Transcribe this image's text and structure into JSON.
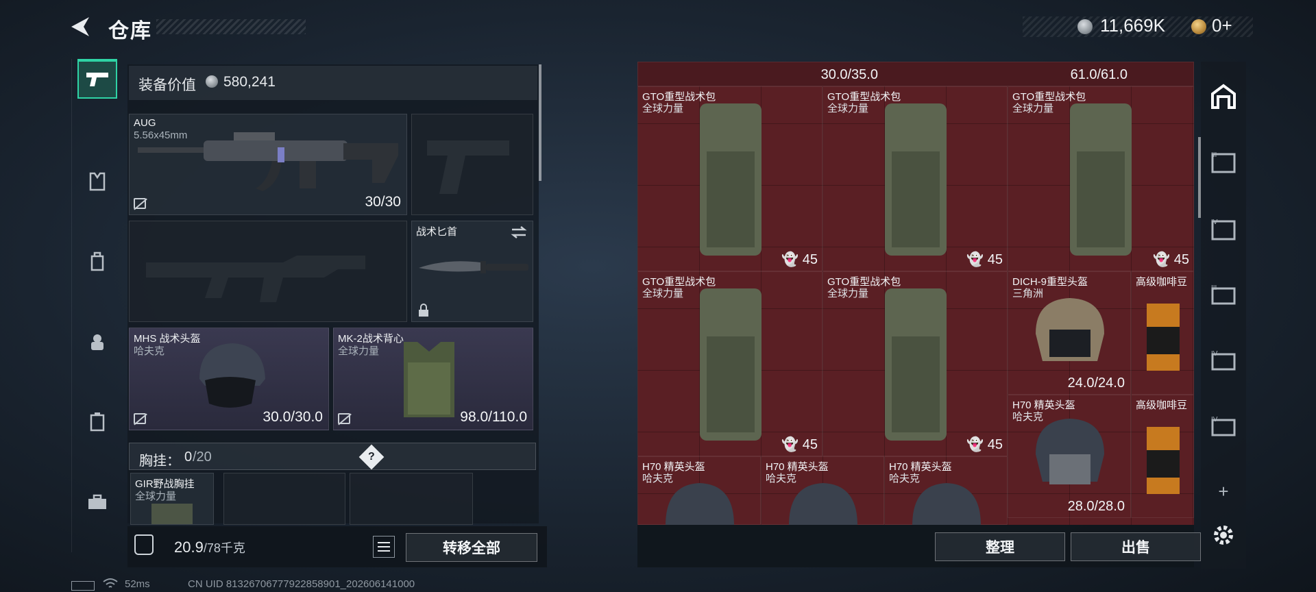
{
  "header": {
    "title": "仓库",
    "money": "11,669K",
    "gold": "0+"
  },
  "tabs": [
    {
      "icon": "pistol-icon",
      "active": true
    },
    {
      "icon": "vest-icon"
    },
    {
      "icon": "backpack-icon"
    },
    {
      "icon": "rig-icon"
    },
    {
      "icon": "case-icon"
    },
    {
      "icon": "toolbox-icon"
    }
  ],
  "loadout": {
    "equip_value_label": "装备价值",
    "equip_value": "580,241",
    "primary": {
      "name": "AUG",
      "caliber": "5.56x45mm",
      "ammo": "30/30"
    },
    "knife": {
      "name": "战术匕首"
    },
    "helmet": {
      "name": "MHS 战术头盔",
      "brand": "哈夫克",
      "durability": "30.0/30.0"
    },
    "armor": {
      "name": "MK-2战术背心",
      "brand": "全球力量",
      "durability": "98.0/110.0"
    },
    "chest_label": "胸挂：",
    "chest_count": "0",
    "chest_capacity": "/20",
    "chest_item": {
      "name": "GIR野战胸挂",
      "brand": "全球力量"
    },
    "weight": "20.9",
    "weight_max": "/78千克",
    "transfer_all": "转移全部"
  },
  "storage": {
    "top_row": [
      "30.0/35.0",
      "61.0/61.0"
    ],
    "items": [
      {
        "name": "GTO重型战术包",
        "brand": "全球力量",
        "count": "45"
      },
      {
        "name": "GTO重型战术包",
        "brand": "全球力量",
        "count": "45"
      },
      {
        "name": "GTO重型战术包",
        "brand": "全球力量",
        "count": "45"
      },
      {
        "name": "GTO重型战术包",
        "brand": "全球力量",
        "count": "45"
      },
      {
        "name": "GTO重型战术包",
        "brand": "全球力量",
        "count": "45"
      },
      {
        "name": "DICH-9重型头盔",
        "brand": "三角洲",
        "durability": "24.0/24.0"
      },
      {
        "name": "高级咖啡豆"
      },
      {
        "name": "H70 精英头盔",
        "brand": "哈夫克",
        "durability": "28.0/28.0"
      },
      {
        "name": "高级咖啡豆"
      },
      {
        "name": "H70 精英头盔",
        "brand": "哈夫克"
      },
      {
        "name": "H70 精英头盔",
        "brand": "哈夫克"
      },
      {
        "name": "H70 精英头盔",
        "brand": "哈夫克"
      }
    ],
    "sort_btn": "整理",
    "sell_btn": "出售"
  },
  "status": {
    "ping": "52ms",
    "uid": "CN UID 813267067779228589​01_202606141000"
  },
  "colors": {
    "accent": "#2fd4a6",
    "grid_bg": "#5a1f24"
  }
}
